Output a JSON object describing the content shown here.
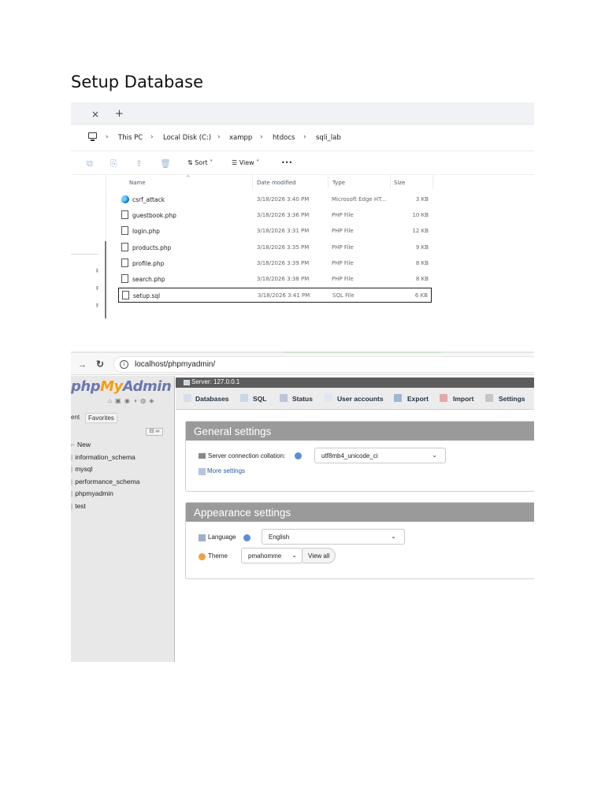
{
  "document": {
    "title": "Setup Database"
  },
  "explorer": {
    "tab_close": "×",
    "tab_new": "+",
    "breadcrumbs": [
      "This PC",
      "Local Disk (C:)",
      "xampp",
      "htdocs",
      "sqli_lab"
    ],
    "toolbar": {
      "sort_label": "Sort",
      "view_label": "View",
      "more_label": "•••"
    },
    "columns": [
      "Name",
      "Date modified",
      "Type",
      "Size"
    ],
    "files": [
      {
        "name": "csrf_attack",
        "date": "3/18/2026 3:40 PM",
        "type": "Microsoft Edge HT...",
        "size": "3 KB",
        "icon": "edge-icon"
      },
      {
        "name": "guestbook.php",
        "date": "3/18/2026 3:36 PM",
        "type": "PHP File",
        "size": "10 KB",
        "icon": "file-icon"
      },
      {
        "name": "login.php",
        "date": "3/18/2026 3:31 PM",
        "type": "PHP File",
        "size": "12 KB",
        "icon": "file-icon"
      },
      {
        "name": "products.php",
        "date": "3/18/2026 3:35 PM",
        "type": "PHP File",
        "size": "9 KB",
        "icon": "file-icon"
      },
      {
        "name": "profile.php",
        "date": "3/18/2026 3:39 PM",
        "type": "PHP File",
        "size": "8 KB",
        "icon": "file-icon"
      },
      {
        "name": "search.php",
        "date": "3/18/2026 3:38 PM",
        "type": "PHP File",
        "size": "8 KB",
        "icon": "file-icon"
      },
      {
        "name": "setup.sql",
        "date": "3/18/2026 3:41 PM",
        "type": "SQL File",
        "size": "6 KB",
        "icon": "file-icon",
        "selected": true
      }
    ]
  },
  "browser": {
    "url": "localhost/phpmyadmin/"
  },
  "pma": {
    "logo": {
      "php": "php",
      "my": "My",
      "admin": "Admin"
    },
    "quick_icons": "⌂ ▣ ◉ ◑ ◍ ◈",
    "recent_label": "ent",
    "favorites_label": "Favorites",
    "collapse_label": "⊟ ∞",
    "databases": [
      "New",
      "information_schema",
      "mysql",
      "performance_schema",
      "phpmyadmin",
      "test"
    ],
    "server_label": "Server: 127.0.0.1",
    "tabs": [
      "Databases",
      "SQL",
      "Status",
      "User accounts",
      "Export",
      "Import",
      "Settings"
    ],
    "general": {
      "heading": "General settings",
      "collation_label": "Server connection collation:",
      "collation_value": "utf8mb4_unicode_ci",
      "more_settings": "More settings"
    },
    "appearance": {
      "heading": "Appearance settings",
      "language_label": "Language",
      "language_value": "English",
      "theme_label": "Theme",
      "theme_value": "pmahomme",
      "view_all": "View all"
    }
  },
  "colors": {
    "pma_logo_blue": "#6c78af",
    "pma_logo_orange": "#f89c0e",
    "panel_header": "#9a9a9a",
    "link": "#235a9f"
  }
}
